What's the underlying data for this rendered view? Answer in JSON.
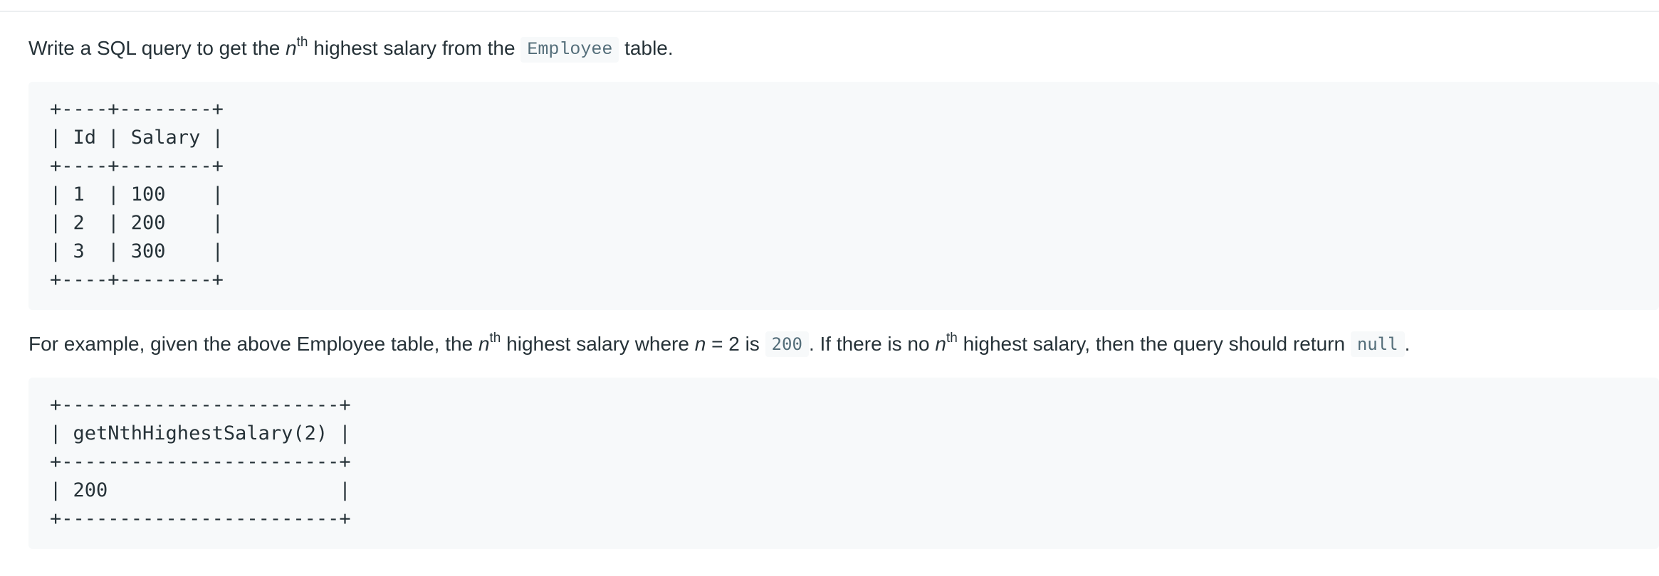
{
  "paragraph1": {
    "before": "Write a SQL query to get the ",
    "n": "n",
    "sup": "th",
    "middle": " highest salary from the ",
    "code": "Employee",
    "after": " table."
  },
  "table1": {
    "lines": [
      "+----+--------+",
      "| Id | Salary |",
      "+----+--------+",
      "| 1  | 100    |",
      "| 2  | 200    |",
      "| 3  | 300    |",
      "+----+--------+"
    ]
  },
  "paragraph2": {
    "t1": "For example, given the above Employee table, the ",
    "n1": "n",
    "sup1": "th",
    "t2": " highest salary where ",
    "n2": "n",
    "t3": " = 2 is ",
    "code1": "200",
    "t4": ". If there is no ",
    "n3": "n",
    "sup2": "th",
    "t5": " highest salary, then the query should return ",
    "code2": "null",
    "t6": "."
  },
  "table2": {
    "lines": [
      "+------------------------+",
      "| getNthHighestSalary(2) |",
      "+------------------------+",
      "| 200                    |",
      "+------------------------+"
    ]
  }
}
